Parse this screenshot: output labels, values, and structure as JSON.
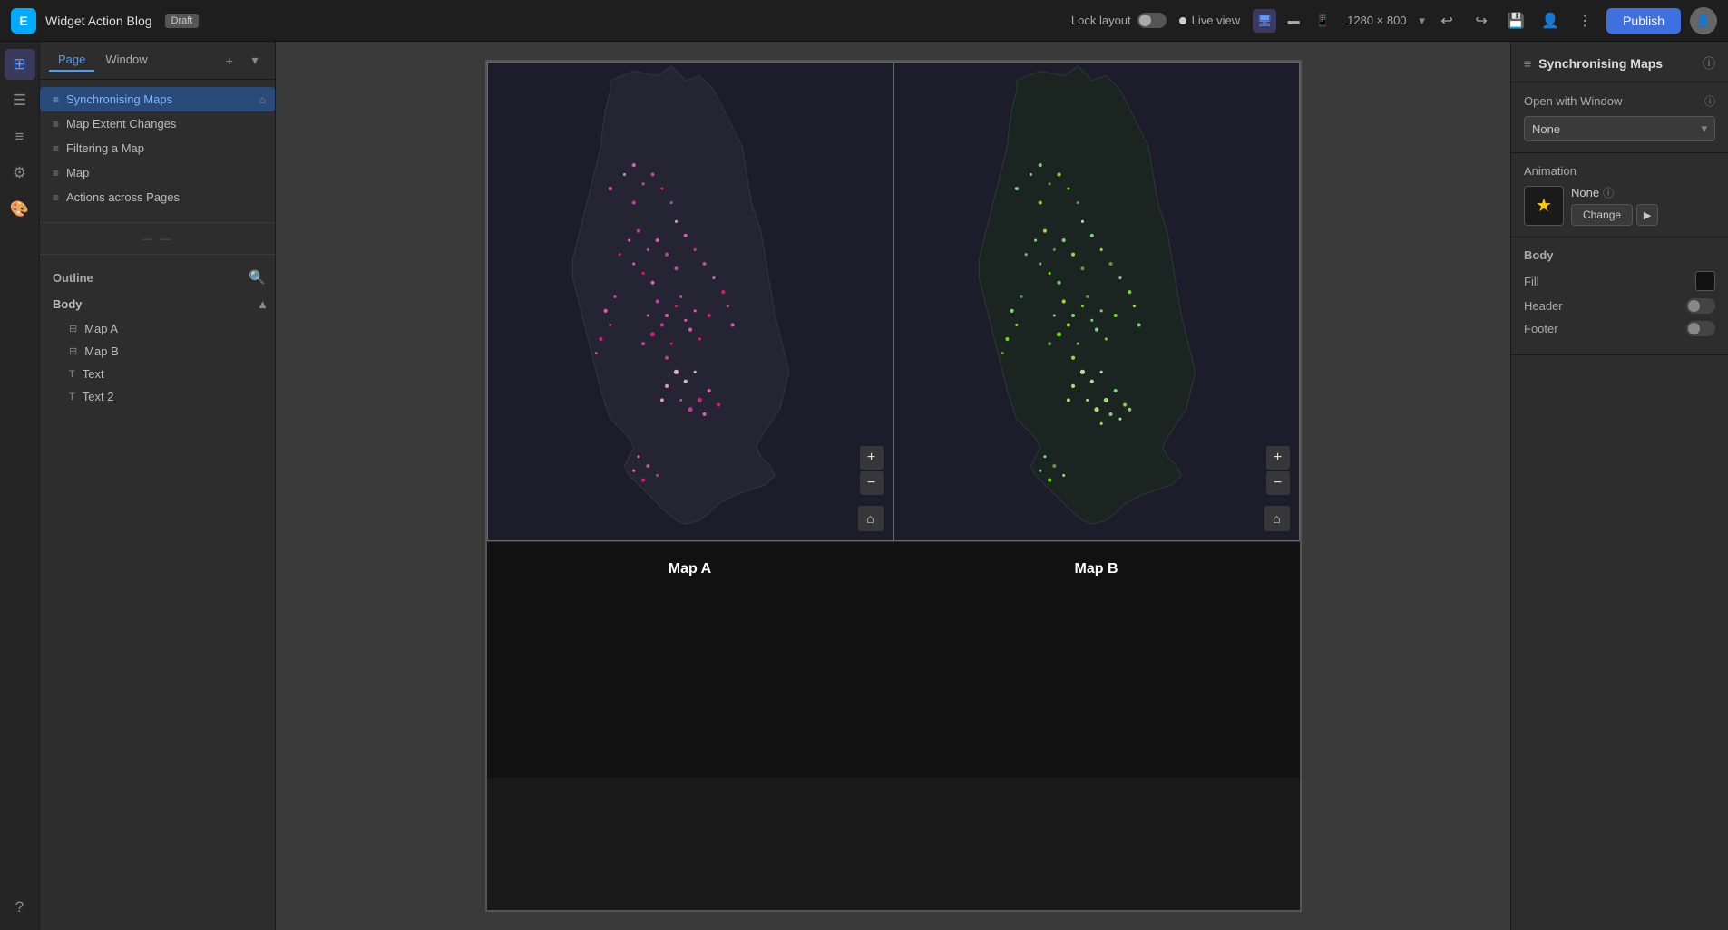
{
  "app": {
    "title": "Widget Action Blog",
    "draft_label": "Draft",
    "logo_letter": "E"
  },
  "topbar": {
    "lock_layout_label": "Lock layout",
    "live_view_label": "Live view",
    "resolution": "1280 × 800",
    "publish_label": "Publish"
  },
  "tabs": {
    "page_label": "Page",
    "window_label": "Window"
  },
  "pages": [
    {
      "label": "Synchronising Maps",
      "active": true,
      "has_home": true
    },
    {
      "label": "Map Extent Changes",
      "active": false,
      "has_home": false
    },
    {
      "label": "Filtering a Map",
      "active": false,
      "has_home": false
    },
    {
      "label": "Map",
      "active": false,
      "has_home": false
    },
    {
      "label": "Actions across Pages",
      "active": false,
      "has_home": false
    }
  ],
  "outline": {
    "title": "Outline",
    "body_label": "Body",
    "items": [
      {
        "label": "Map A",
        "type": "map"
      },
      {
        "label": "Map B",
        "type": "map"
      },
      {
        "label": "Text",
        "type": "text"
      },
      {
        "label": "Text 2",
        "type": "text"
      }
    ]
  },
  "canvas": {
    "map_a_label": "Map A",
    "map_b_label": "Map B"
  },
  "right_panel": {
    "title": "Synchronising Maps",
    "open_with_window_label": "Open with Window",
    "open_with_window_value": "None",
    "animation_label": "Animation",
    "animation_value": "None",
    "animation_change_label": "Change",
    "body_label": "Body",
    "fill_label": "Fill",
    "header_label": "Header",
    "footer_label": "Footer"
  },
  "icons": {
    "add": "+",
    "grid": "⊞",
    "layers": "≡",
    "settings": "⚙",
    "paint": "🎨",
    "wrench": "🔧",
    "help": "?",
    "user": "👤",
    "search": "🔍",
    "home": "⌂",
    "chevron_down": "▾",
    "chevron_up": "▴",
    "info": "ⓘ",
    "undo": "↩",
    "redo": "↪",
    "save": "💾",
    "dots": "⋮",
    "desktop": "🖥",
    "tablet": "▬",
    "mobile": "📱",
    "star": "★",
    "map_icon": "⊞",
    "text_icon": "T"
  }
}
